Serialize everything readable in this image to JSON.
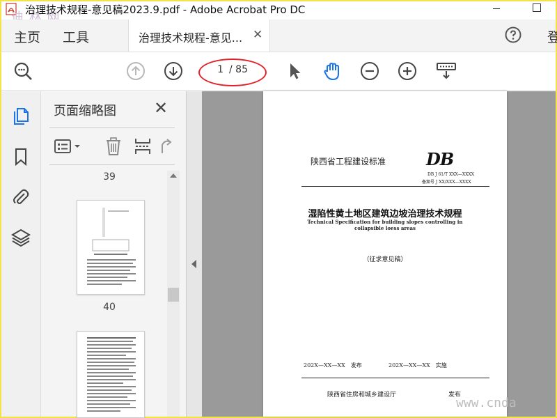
{
  "window": {
    "title": "治理技术规程-意见稿2023.9.pdf - Adobe Acrobat Pro DC",
    "watermark_top": "迪 林 网"
  },
  "menu": {
    "home": "主页",
    "tools": "工具",
    "doc_tab": "治理技术规程-意见...",
    "doc_tab_close": "✕",
    "signin": "登"
  },
  "toolbar": {
    "page_current": "1",
    "page_total": "/ 85",
    "icons": [
      "search-icon",
      "page-up-icon",
      "page-down-icon",
      "select-pointer-icon",
      "hand-tool-icon",
      "zoom-out-icon",
      "zoom-in-icon",
      "read-mode-icon"
    ]
  },
  "colors": {
    "accent": "#1a73e8",
    "annotation_circle": "#e0232b",
    "frame": "#f2e34a"
  },
  "sidebar": {
    "panel_title": "页面缩略图",
    "panel_close": "✕",
    "thumbnails": [
      {
        "page_label": "39"
      },
      {
        "page_label": "40"
      }
    ]
  },
  "document": {
    "standard_name": "陕西省工程建设标准",
    "db_mark": "DB",
    "code": "DB J 61/T XXX—XXXX",
    "record": "备案号 J XX/XXX—XXXX",
    "title_cn": "湿陷性黄土地区建筑边坡治理技术规程",
    "title_en_line1": "Technical Specification for building slopes controlling in",
    "title_en_line2": "collapsible loess areas",
    "draft": "（征求意见稿）",
    "issue_date": "202X—XX—XX　发布",
    "impl_date": "202X—XX—XX　实施",
    "publisher": "陕西省住房和城乡建设厅",
    "publish_word": "发布"
  },
  "watermark_bottom": "www.cnda"
}
